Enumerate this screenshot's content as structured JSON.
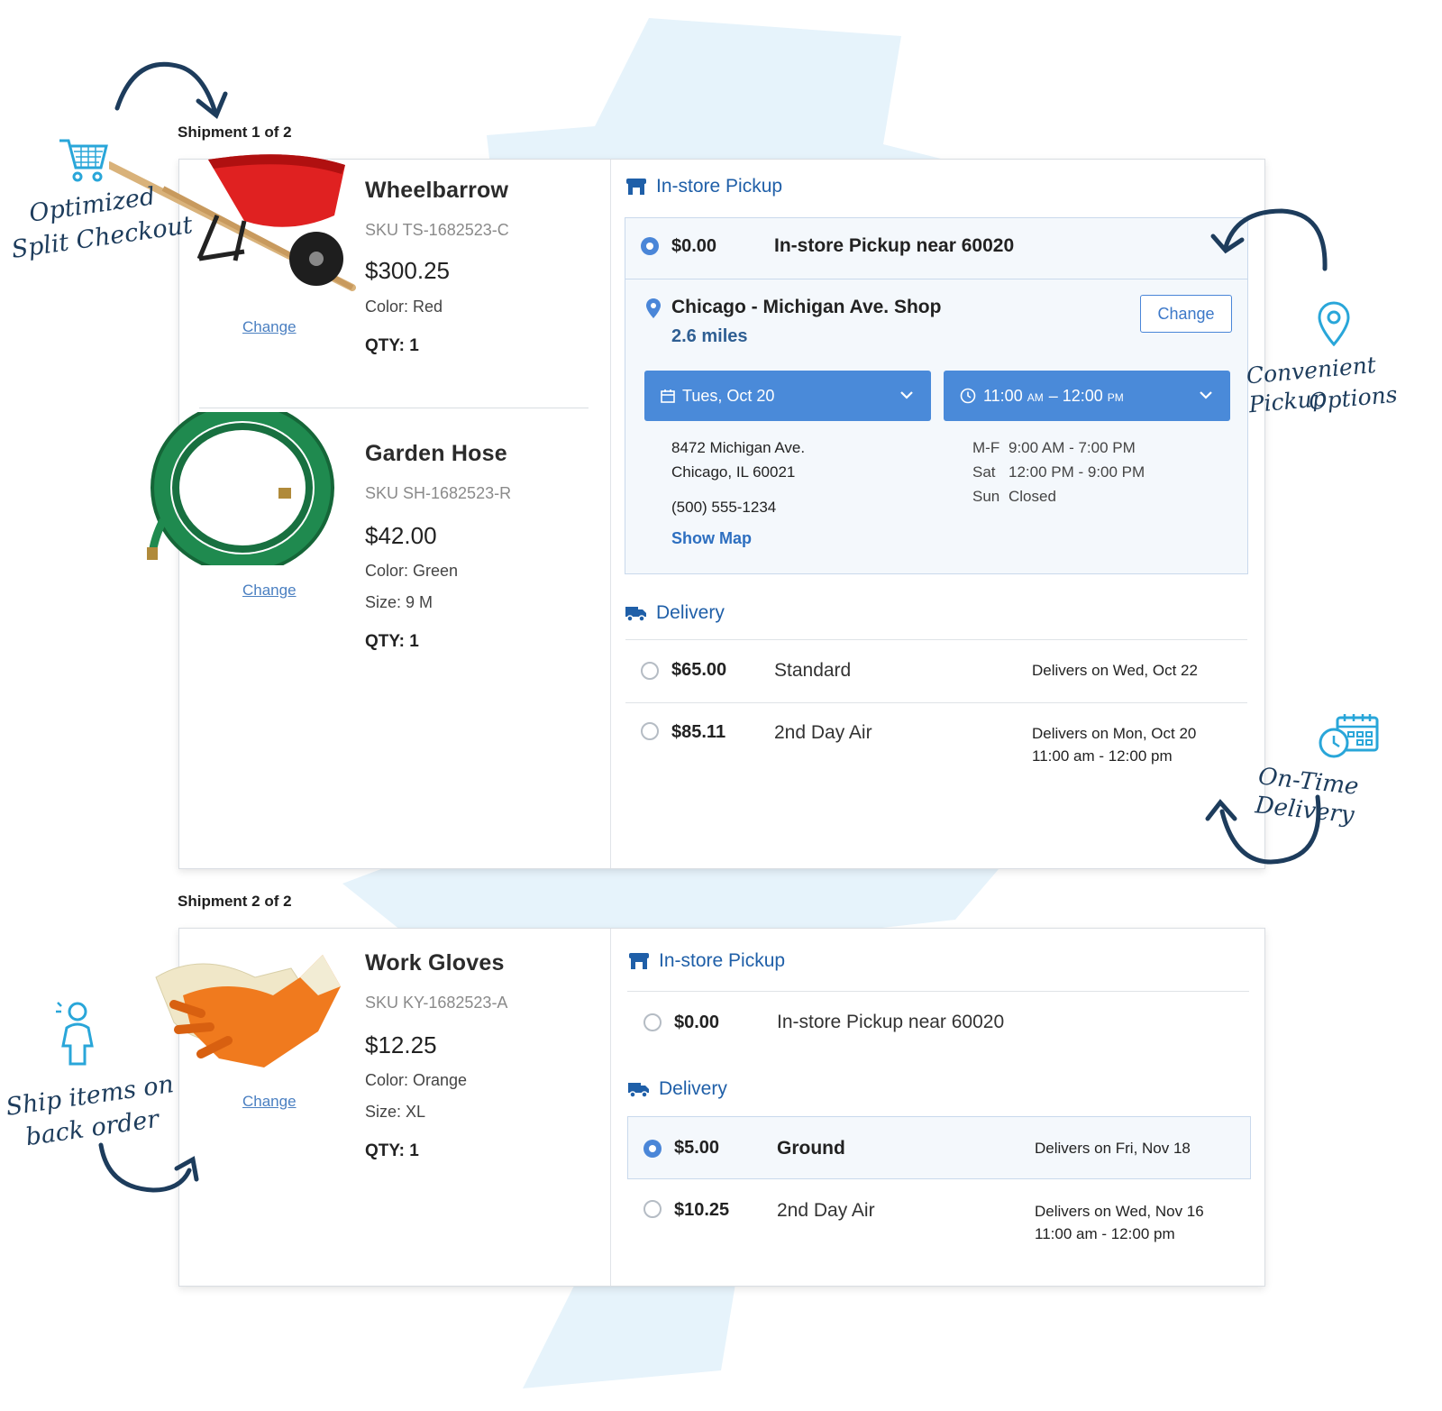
{
  "annotations": {
    "split_checkout": [
      "Optimized",
      "Split Checkout"
    ],
    "pickup_options": [
      "Convenient Pickup",
      "Options"
    ],
    "on_time": "On-Time Delivery",
    "back_order": [
      "Ship items on",
      "back order"
    ]
  },
  "shipments": [
    {
      "label": "Shipment 1 of 2",
      "products": [
        {
          "name": "Wheelbarrow",
          "sku": "SKU TS-1682523-C",
          "price": "$300.25",
          "attrs": [
            "Color: Red"
          ],
          "qty": "QTY: 1",
          "change": "Change"
        },
        {
          "name": "Garden Hose",
          "sku": "SKU SH-1682523-R",
          "price": "$42.00",
          "attrs": [
            "Color: Green",
            "Size: 9 M"
          ],
          "qty": "QTY: 1",
          "change": "Change"
        }
      ],
      "pickup": {
        "heading": "In-store Pickup",
        "price": "$0.00",
        "label": "In-store Pickup near 60020",
        "store_name": "Chicago - Michigan Ave. Shop",
        "distance": "2.6 miles",
        "change_button": "Change",
        "date_select": "Tues, Oct 20",
        "time_select_start": "11:00",
        "time_select_am": "AM",
        "time_select_dash": "– 12:00",
        "time_select_pm": "PM",
        "address_line1": "8472 Michigan Ave.",
        "address_line2": "Chicago, IL 60021",
        "phone": "(500) 555-1234",
        "show_map": "Show Map",
        "hours": [
          {
            "day": "M-F",
            "time": "9:00 AM - 7:00 PM"
          },
          {
            "day": "Sat",
            "time": "12:00 PM - 9:00 PM"
          },
          {
            "day": "Sun",
            "time": "Closed"
          }
        ]
      },
      "delivery": {
        "heading": "Delivery",
        "options": [
          {
            "price": "$65.00",
            "method": "Standard",
            "eta": [
              "Delivers on Wed, Oct 22"
            ]
          },
          {
            "price": "$85.11",
            "method": "2nd Day Air",
            "eta": [
              "Delivers on Mon, Oct 20",
              "11:00 am - 12:00 pm"
            ]
          }
        ]
      }
    },
    {
      "label": "Shipment 2 of 2",
      "products": [
        {
          "name": "Work Gloves",
          "sku": "SKU KY-1682523-A",
          "price": "$12.25",
          "attrs": [
            "Color: Orange",
            "Size: XL"
          ],
          "qty": "QTY: 1",
          "change": "Change"
        }
      ],
      "pickup": {
        "heading": "In-store Pickup",
        "price": "$0.00",
        "label": "In-store Pickup near 60020"
      },
      "delivery": {
        "heading": "Delivery",
        "options": [
          {
            "price": "$5.00",
            "method": "Ground",
            "eta": [
              "Delivers on Fri, Nov 18"
            ]
          },
          {
            "price": "$10.25",
            "method": "2nd Day Air",
            "eta": [
              "Delivers on Wed, Nov 16",
              "11:00 am - 12:00 pm"
            ]
          }
        ]
      }
    }
  ],
  "colors": {
    "accent": "#4a8ad9",
    "heading_blue": "#1f5fa8",
    "annotation_navy": "#1d3c5c",
    "splash": "#e3f1fa"
  }
}
